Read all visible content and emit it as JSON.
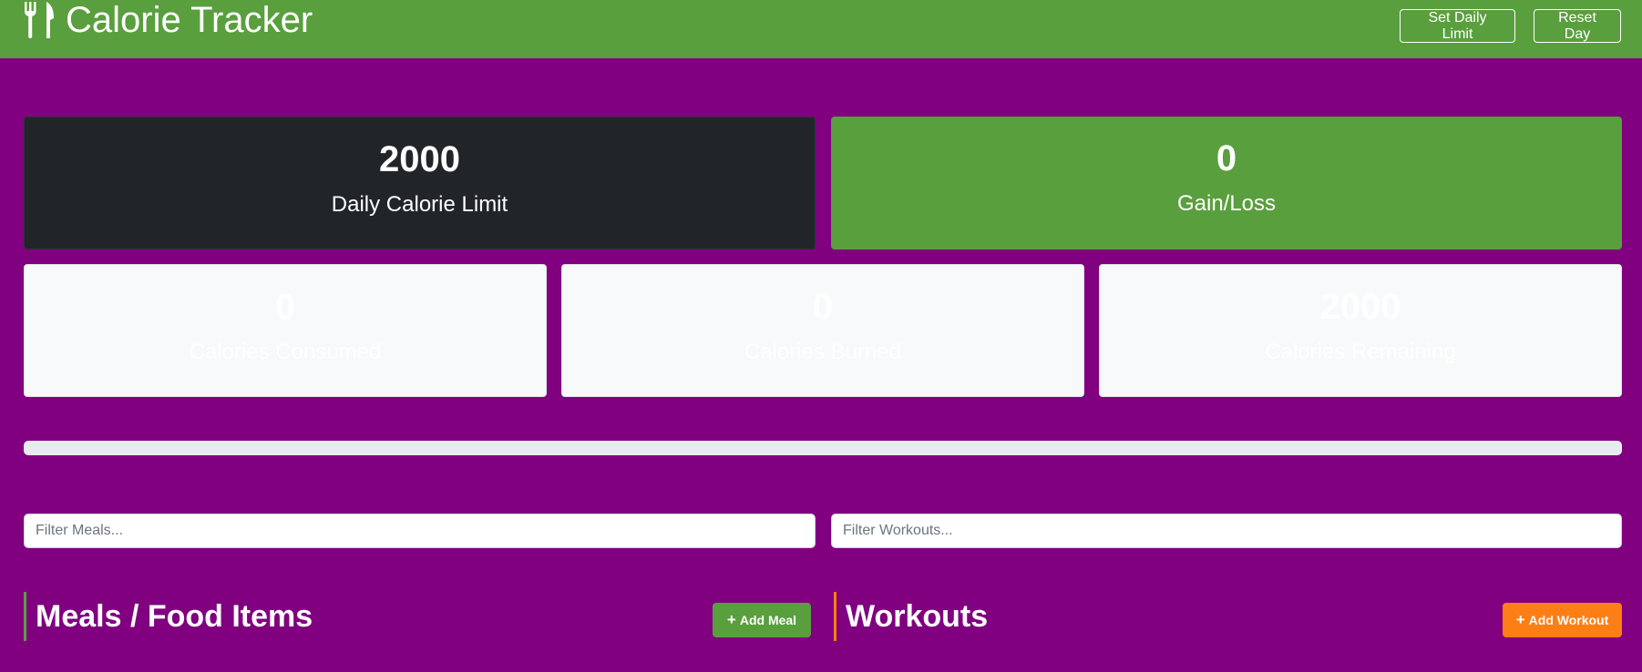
{
  "navbar": {
    "title": "Calorie Tracker",
    "brand_icon": "utensils-icon",
    "set_limit_label": "Set Daily Limit",
    "reset_label": "Reset Day"
  },
  "stats": {
    "limit": {
      "value": "2000",
      "label": "Daily Calorie Limit"
    },
    "gain_loss": {
      "value": "0",
      "label": "Gain/Loss"
    },
    "consumed": {
      "value": "0",
      "label": "Calories Consumed"
    },
    "burned": {
      "value": "0",
      "label": "Calories Burned"
    },
    "remaining": {
      "value": "2000",
      "label": "Calories Remaining"
    }
  },
  "progress": {
    "percent": 0
  },
  "filters": {
    "meals_placeholder": "Filter Meals...",
    "workouts_placeholder": "Filter Workouts..."
  },
  "sections": {
    "meals_title": "Meals / Food Items",
    "add_meal_label": "Add Meal",
    "workouts_title": "Workouts",
    "add_workout_label": "Add Workout"
  },
  "colors": {
    "background": "#800080",
    "primary": "#5a9f3e",
    "dark": "#212529",
    "light": "#f8f9fa",
    "accent": "#fd7e14"
  }
}
